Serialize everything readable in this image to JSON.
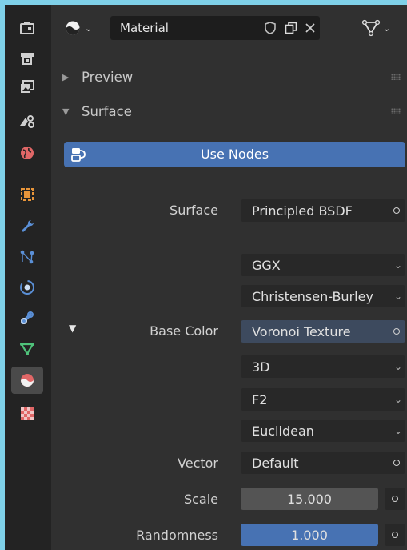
{
  "header": {
    "datablock_name": "Material"
  },
  "panels": {
    "preview_label": "Preview",
    "surface_label": "Surface"
  },
  "use_nodes_label": "Use Nodes",
  "props": {
    "surface": {
      "label": "Surface",
      "value": "Principled BSDF"
    },
    "distribution": {
      "value": "GGX"
    },
    "subsurface_method": {
      "value": "Christensen-Burley"
    },
    "base_color": {
      "label": "Base Color",
      "value": "Voronoi Texture"
    },
    "dimensions": {
      "value": "3D"
    },
    "feature": {
      "value": "F2"
    },
    "distance": {
      "value": "Euclidean"
    },
    "vector": {
      "label": "Vector",
      "value": "Default"
    },
    "scale": {
      "label": "Scale",
      "value": "15.000"
    },
    "randomness": {
      "label": "Randomness",
      "value": "1.000",
      "fraction": 1.0
    }
  },
  "sidebar_icons": [
    "tool-icon",
    "render-icon",
    "output-icon",
    "view-layer-icon",
    "scene-icon",
    "world-icon",
    "object-icon",
    "modifiers-icon",
    "particles-icon",
    "physics-icon",
    "constraints-icon",
    "data-icon",
    "material-icon",
    "texture-icon"
  ],
  "colors": {
    "accent": "#4772b3",
    "panel_bg": "#303030",
    "field_bg": "#282828",
    "outer_bg": "#7fd0e8"
  }
}
